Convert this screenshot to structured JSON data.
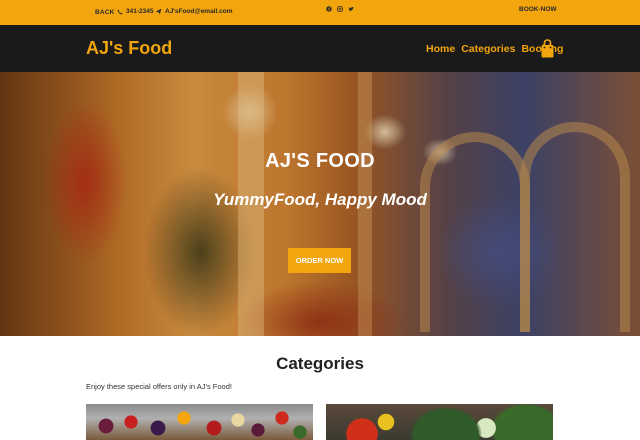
{
  "topbar": {
    "back_label": "BACK",
    "phone": "341-2345",
    "email": "AJ'sFood@email.com",
    "social_icons": [
      "facebook-icon",
      "instagram-icon",
      "twitter-icon"
    ],
    "book_now_label": "BOOK-NOW"
  },
  "navbar": {
    "brand": "AJ's Food",
    "links": [
      "Home",
      "Categories",
      "Booking"
    ],
    "cart_icon": "shopping-bag-icon"
  },
  "hero": {
    "title": "AJ'S FOOD",
    "tagline": "YummyFood, Happy Mood",
    "order_button": "ORDER NOW"
  },
  "categories": {
    "heading": "Categories",
    "description": "Enjoy these special offers only in AJ's Food!"
  },
  "colors": {
    "accent": "#f2a50c",
    "nav_bg": "#1a1a1a"
  }
}
